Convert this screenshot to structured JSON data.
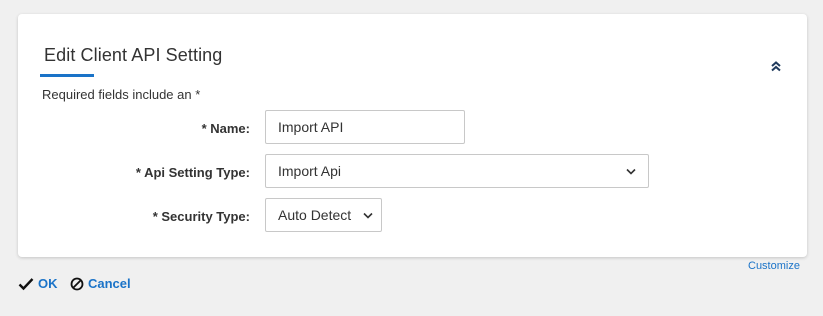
{
  "form": {
    "title": "Edit Client API Setting",
    "required_note": "Required fields include an *",
    "fields": {
      "name": {
        "label": "* Name:",
        "value": "Import API"
      },
      "api_setting_type": {
        "label": "* Api Setting Type:",
        "value": "Import Api"
      },
      "security_type": {
        "label": "* Security Type:",
        "value": "Auto Detect"
      }
    }
  },
  "links": {
    "customize": "Customize"
  },
  "actions": {
    "ok_label": "OK",
    "cancel_label": "Cancel"
  },
  "icons": {
    "collapse": "double-chevron-up-icon",
    "ok": "checkmark-icon",
    "cancel": "cancel-circle-icon",
    "dropdown": "chevron-down-icon"
  },
  "colors": {
    "accent": "#1a73c8",
    "background": "#f0f0f0",
    "card": "#ffffff",
    "text": "#333333"
  }
}
